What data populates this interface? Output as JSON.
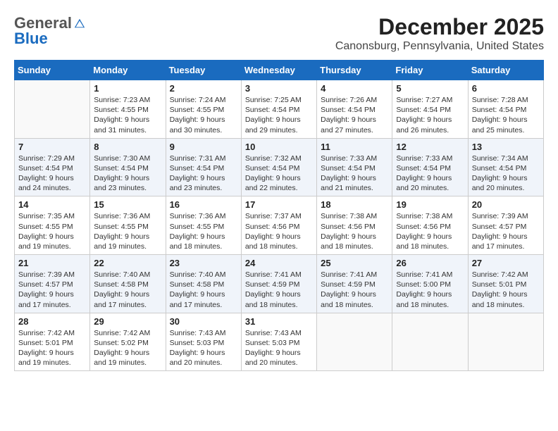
{
  "logo": {
    "general": "General",
    "blue": "Blue"
  },
  "title": "December 2025",
  "subtitle": "Canonsburg, Pennsylvania, United States",
  "days_header": [
    "Sunday",
    "Monday",
    "Tuesday",
    "Wednesday",
    "Thursday",
    "Friday",
    "Saturday"
  ],
  "weeks": [
    [
      {
        "day": "",
        "info": ""
      },
      {
        "day": "1",
        "info": "Sunrise: 7:23 AM\nSunset: 4:55 PM\nDaylight: 9 hours\nand 31 minutes."
      },
      {
        "day": "2",
        "info": "Sunrise: 7:24 AM\nSunset: 4:55 PM\nDaylight: 9 hours\nand 30 minutes."
      },
      {
        "day": "3",
        "info": "Sunrise: 7:25 AM\nSunset: 4:54 PM\nDaylight: 9 hours\nand 29 minutes."
      },
      {
        "day": "4",
        "info": "Sunrise: 7:26 AM\nSunset: 4:54 PM\nDaylight: 9 hours\nand 27 minutes."
      },
      {
        "day": "5",
        "info": "Sunrise: 7:27 AM\nSunset: 4:54 PM\nDaylight: 9 hours\nand 26 minutes."
      },
      {
        "day": "6",
        "info": "Sunrise: 7:28 AM\nSunset: 4:54 PM\nDaylight: 9 hours\nand 25 minutes."
      }
    ],
    [
      {
        "day": "7",
        "info": "Sunrise: 7:29 AM\nSunset: 4:54 PM\nDaylight: 9 hours\nand 24 minutes."
      },
      {
        "day": "8",
        "info": "Sunrise: 7:30 AM\nSunset: 4:54 PM\nDaylight: 9 hours\nand 23 minutes."
      },
      {
        "day": "9",
        "info": "Sunrise: 7:31 AM\nSunset: 4:54 PM\nDaylight: 9 hours\nand 23 minutes."
      },
      {
        "day": "10",
        "info": "Sunrise: 7:32 AM\nSunset: 4:54 PM\nDaylight: 9 hours\nand 22 minutes."
      },
      {
        "day": "11",
        "info": "Sunrise: 7:33 AM\nSunset: 4:54 PM\nDaylight: 9 hours\nand 21 minutes."
      },
      {
        "day": "12",
        "info": "Sunrise: 7:33 AM\nSunset: 4:54 PM\nDaylight: 9 hours\nand 20 minutes."
      },
      {
        "day": "13",
        "info": "Sunrise: 7:34 AM\nSunset: 4:54 PM\nDaylight: 9 hours\nand 20 minutes."
      }
    ],
    [
      {
        "day": "14",
        "info": "Sunrise: 7:35 AM\nSunset: 4:55 PM\nDaylight: 9 hours\nand 19 minutes."
      },
      {
        "day": "15",
        "info": "Sunrise: 7:36 AM\nSunset: 4:55 PM\nDaylight: 9 hours\nand 19 minutes."
      },
      {
        "day": "16",
        "info": "Sunrise: 7:36 AM\nSunset: 4:55 PM\nDaylight: 9 hours\nand 18 minutes."
      },
      {
        "day": "17",
        "info": "Sunrise: 7:37 AM\nSunset: 4:56 PM\nDaylight: 9 hours\nand 18 minutes."
      },
      {
        "day": "18",
        "info": "Sunrise: 7:38 AM\nSunset: 4:56 PM\nDaylight: 9 hours\nand 18 minutes."
      },
      {
        "day": "19",
        "info": "Sunrise: 7:38 AM\nSunset: 4:56 PM\nDaylight: 9 hours\nand 18 minutes."
      },
      {
        "day": "20",
        "info": "Sunrise: 7:39 AM\nSunset: 4:57 PM\nDaylight: 9 hours\nand 17 minutes."
      }
    ],
    [
      {
        "day": "21",
        "info": "Sunrise: 7:39 AM\nSunset: 4:57 PM\nDaylight: 9 hours\nand 17 minutes."
      },
      {
        "day": "22",
        "info": "Sunrise: 7:40 AM\nSunset: 4:58 PM\nDaylight: 9 hours\nand 17 minutes."
      },
      {
        "day": "23",
        "info": "Sunrise: 7:40 AM\nSunset: 4:58 PM\nDaylight: 9 hours\nand 17 minutes."
      },
      {
        "day": "24",
        "info": "Sunrise: 7:41 AM\nSunset: 4:59 PM\nDaylight: 9 hours\nand 18 minutes."
      },
      {
        "day": "25",
        "info": "Sunrise: 7:41 AM\nSunset: 4:59 PM\nDaylight: 9 hours\nand 18 minutes."
      },
      {
        "day": "26",
        "info": "Sunrise: 7:41 AM\nSunset: 5:00 PM\nDaylight: 9 hours\nand 18 minutes."
      },
      {
        "day": "27",
        "info": "Sunrise: 7:42 AM\nSunset: 5:01 PM\nDaylight: 9 hours\nand 18 minutes."
      }
    ],
    [
      {
        "day": "28",
        "info": "Sunrise: 7:42 AM\nSunset: 5:01 PM\nDaylight: 9 hours\nand 19 minutes."
      },
      {
        "day": "29",
        "info": "Sunrise: 7:42 AM\nSunset: 5:02 PM\nDaylight: 9 hours\nand 19 minutes."
      },
      {
        "day": "30",
        "info": "Sunrise: 7:43 AM\nSunset: 5:03 PM\nDaylight: 9 hours\nand 20 minutes."
      },
      {
        "day": "31",
        "info": "Sunrise: 7:43 AM\nSunset: 5:03 PM\nDaylight: 9 hours\nand 20 minutes."
      },
      {
        "day": "",
        "info": ""
      },
      {
        "day": "",
        "info": ""
      },
      {
        "day": "",
        "info": ""
      }
    ]
  ]
}
